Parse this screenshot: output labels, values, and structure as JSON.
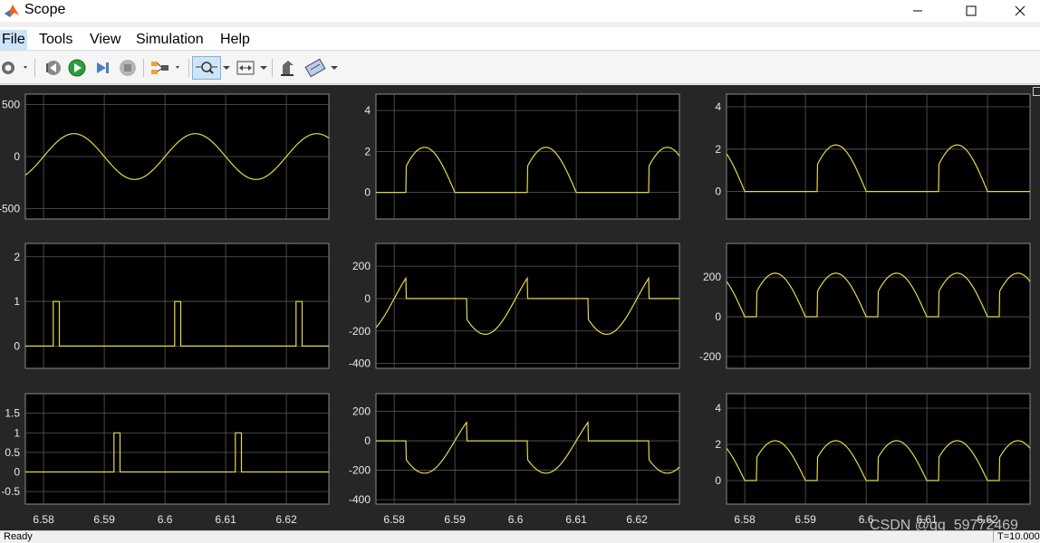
{
  "window": {
    "title": "Scope",
    "controls": [
      "minimize-icon",
      "maximize-icon",
      "close-icon"
    ]
  },
  "menu": {
    "items": [
      "File",
      "Tools",
      "View",
      "Simulation",
      "Help"
    ],
    "active": "File"
  },
  "toolbar": {
    "icons": [
      "settings-gear-icon",
      "step-back-icon",
      "run-icon",
      "step-forward-icon",
      "stop-icon",
      "signal-selector-icon",
      "zoom-icon",
      "autoscale-icon",
      "highlight-icon",
      "measurement-icon"
    ],
    "selected": "zoom-icon"
  },
  "status": {
    "left": "Ready",
    "right": "T=10.000"
  },
  "watermark": "CSDN @qq_59772469",
  "colors": {
    "trace": "#e6d94a",
    "axes_bg": "#000000",
    "figure_bg": "#262626",
    "grid": "#5a5a5a",
    "tick_text": "#e8e8e8"
  },
  "chart_data": [
    {
      "type": "line",
      "name_hint": "ac-source",
      "xlim": [
        6.577,
        6.627
      ],
      "ylim": [
        -600,
        600
      ],
      "yticks": [
        -500,
        0,
        500
      ],
      "ytick_labels": [
        "-500",
        "0",
        "500"
      ],
      "xticks": [
        6.58,
        6.59,
        6.6,
        6.61,
        6.62
      ],
      "xtick_labels": [],
      "grid": true,
      "wave": {
        "kind": "sine",
        "amplitude": 220,
        "frequency": 50,
        "phase_zero": 6.58
      }
    },
    {
      "type": "line",
      "name_hint": "load-voltage",
      "xlim": [
        6.577,
        6.627
      ],
      "ylim": [
        -1.3,
        4.8
      ],
      "yticks": [
        0,
        2,
        4
      ],
      "ytick_labels": [
        "0",
        "2",
        "4"
      ],
      "xticks": [
        6.58,
        6.59,
        6.6,
        6.61,
        6.62
      ],
      "xtick_labels": [],
      "grid": true,
      "wave": {
        "kind": "gated_half_sine",
        "amplitude": 2.2,
        "frequency": 50,
        "phase_zero": 6.58,
        "fire_angle_deg": 35,
        "polarity": "positive"
      }
    },
    {
      "type": "line",
      "name_hint": "rectified-current",
      "xlim": [
        6.577,
        6.627
      ],
      "ylim": [
        -1.3,
        4.6
      ],
      "yticks": [
        0,
        2,
        4
      ],
      "ytick_labels": [
        "0",
        "2",
        "4"
      ],
      "xticks": [
        6.58,
        6.59,
        6.6,
        6.61,
        6.62
      ],
      "xtick_labels": [],
      "grid": true,
      "wave": {
        "kind": "gated_half_sine",
        "amplitude": 2.2,
        "frequency": 50,
        "phase_zero": 6.58,
        "fire_angle_deg": 35,
        "polarity": "negative"
      }
    },
    {
      "type": "line",
      "name_hint": "gate-pulse-1",
      "xlim": [
        6.577,
        6.627
      ],
      "ylim": [
        -0.5,
        2.3
      ],
      "yticks": [
        0,
        1,
        2
      ],
      "ytick_labels": [
        "0",
        "1",
        "2"
      ],
      "xticks": [
        6.58,
        6.59,
        6.6,
        6.61,
        6.62
      ],
      "xtick_labels": [],
      "grid": true,
      "pulses": [
        [
          6.5816,
          6.5826
        ],
        [
          6.6016,
          6.6026
        ],
        [
          6.6216,
          6.6226
        ]
      ]
    },
    {
      "type": "line",
      "name_hint": "thyristor-voltage-1",
      "xlim": [
        6.577,
        6.627
      ],
      "ylim": [
        -430,
        340
      ],
      "yticks": [
        -400,
        -200,
        0,
        200
      ],
      "ytick_labels": [
        "-400",
        "-200",
        "0",
        "200"
      ],
      "xticks": [
        6.58,
        6.59,
        6.6,
        6.61,
        6.62
      ],
      "xtick_labels": [],
      "grid": true,
      "wave": {
        "kind": "blocked_sine",
        "amplitude": 220,
        "frequency": 50,
        "phase_zero": 6.58,
        "fire_angle_deg": 35,
        "polarity": "positive"
      }
    },
    {
      "type": "line",
      "name_hint": "output-voltage",
      "xlim": [
        6.577,
        6.627
      ],
      "ylim": [
        -260,
        370
      ],
      "yticks": [
        -200,
        0,
        200
      ],
      "ytick_labels": [
        "-200",
        "0",
        "200"
      ],
      "xticks": [
        6.58,
        6.59,
        6.6,
        6.61,
        6.62
      ],
      "xtick_labels": [],
      "grid": true,
      "wave": {
        "kind": "full_rectified_gated",
        "amplitude": 220,
        "frequency": 50,
        "phase_zero": 6.58,
        "fire_angle_deg": 35
      }
    },
    {
      "type": "line",
      "name_hint": "gate-pulse-2",
      "xlim": [
        6.577,
        6.627
      ],
      "ylim": [
        -0.82,
        2.0
      ],
      "yticks": [
        -0.5,
        0,
        0.5,
        1,
        1.5
      ],
      "ytick_labels": [
        "-0.5",
        "0",
        "0.5",
        "1",
        "1.5"
      ],
      "xticks": [
        6.58,
        6.59,
        6.6,
        6.61,
        6.62
      ],
      "xtick_labels": [
        "6.58",
        "6.59",
        "6.6",
        "6.61",
        "6.62"
      ],
      "grid": true,
      "pulses": [
        [
          6.5916,
          6.5926
        ],
        [
          6.6116,
          6.6126
        ]
      ]
    },
    {
      "type": "line",
      "name_hint": "thyristor-voltage-2",
      "xlim": [
        6.577,
        6.627
      ],
      "ylim": [
        -430,
        320
      ],
      "yticks": [
        -400,
        -200,
        0,
        200
      ],
      "ytick_labels": [
        "-400",
        "-200",
        "0",
        "200"
      ],
      "xticks": [
        6.58,
        6.59,
        6.6,
        6.61,
        6.62
      ],
      "xtick_labels": [
        "6.58",
        "6.59",
        "6.6",
        "6.61",
        "6.62"
      ],
      "grid": true,
      "wave": {
        "kind": "blocked_sine",
        "amplitude": 220,
        "frequency": 50,
        "phase_zero": 6.58,
        "fire_angle_deg": 35,
        "polarity": "negative"
      }
    },
    {
      "type": "line",
      "name_hint": "output-current",
      "xlim": [
        6.577,
        6.627
      ],
      "ylim": [
        -1.3,
        4.8
      ],
      "yticks": [
        0,
        2,
        4
      ],
      "ytick_labels": [
        "0",
        "2",
        "4"
      ],
      "xticks": [
        6.58,
        6.59,
        6.6,
        6.61,
        6.62
      ],
      "xtick_labels": [
        "6.58",
        "6.59",
        "6.6",
        "6.61",
        "6.62"
      ],
      "grid": true,
      "wave": {
        "kind": "full_rectified_gated",
        "amplitude": 2.2,
        "frequency": 50,
        "phase_zero": 6.58,
        "fire_angle_deg": 35
      }
    }
  ]
}
